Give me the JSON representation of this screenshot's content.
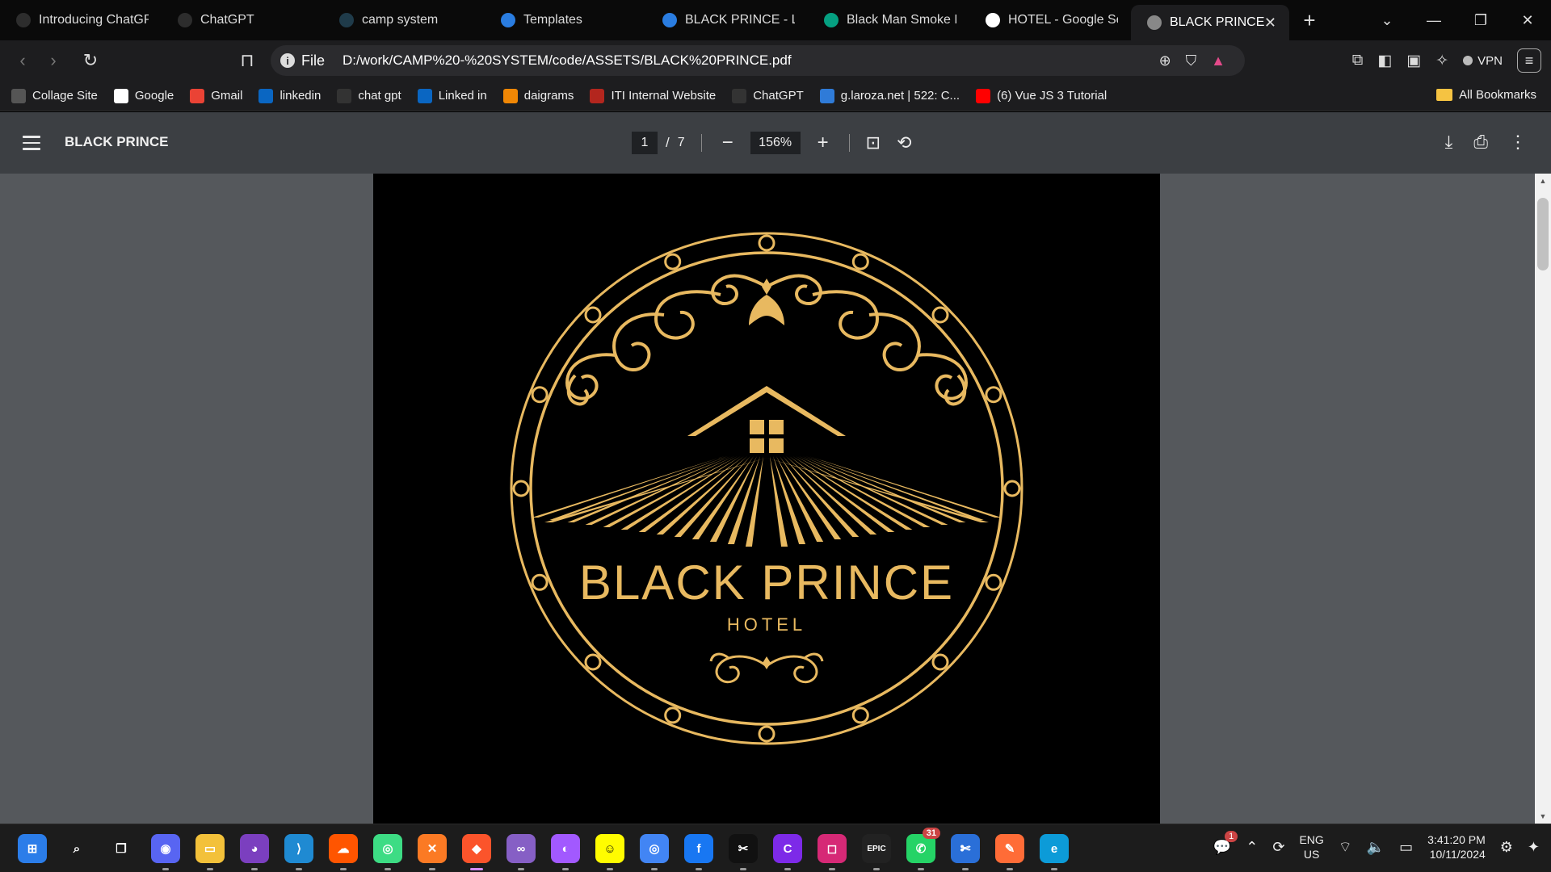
{
  "tabs": [
    {
      "label": "Introducing ChatGPT",
      "icon": "openai-icon",
      "color": "#2d2d2d"
    },
    {
      "label": "ChatGPT",
      "icon": "openai-icon",
      "color": "#2d2d2d"
    },
    {
      "label": "camp system",
      "icon": "react-icon",
      "color": "#1f3b4a"
    },
    {
      "label": "Templates",
      "icon": "canva-icon",
      "color": "#2a7de1"
    },
    {
      "label": "BLACK PRINCE - Logo",
      "icon": "canva-icon",
      "color": "#2a7de1"
    },
    {
      "label": "Black Man Smoke Ph",
      "icon": "pexels-icon",
      "color": "#05a081"
    },
    {
      "label": "HOTEL - Google Sear",
      "icon": "google-icon",
      "color": "#ffffff"
    },
    {
      "label": "BLACK PRINCE",
      "icon": "globe-icon",
      "color": "#888888",
      "active": true
    }
  ],
  "address": {
    "scheme_label": "File",
    "url": "D:/work/CAMP%20-%20SYSTEM/code/ASSETS/BLACK%20PRINCE.pdf"
  },
  "toolbar": {
    "vpn_label": "VPN"
  },
  "bookmarks": [
    {
      "label": "Collage Site",
      "color": "#555555"
    },
    {
      "label": "Google",
      "color": "#ffffff"
    },
    {
      "label": "Gmail",
      "color": "#ea4335"
    },
    {
      "label": "linkedin",
      "color": "#0a66c2"
    },
    {
      "label": "chat gpt",
      "color": "#333333"
    },
    {
      "label": "Linked in",
      "color": "#0a66c2"
    },
    {
      "label": "daigrams",
      "color": "#f08705"
    },
    {
      "label": "ITI Internal Website",
      "color": "#b3261e"
    },
    {
      "label": "ChatGPT",
      "color": "#333333"
    },
    {
      "label": "g.laroza.net | 522: C...",
      "color": "#2f7bd8"
    },
    {
      "label": "(6) Vue JS 3 Tutorial",
      "color": "#ff0000"
    }
  ],
  "bookmarks_all": "All Bookmarks",
  "pdf": {
    "title": "BLACK PRINCE",
    "current_page": "1",
    "total_pages": "7",
    "zoom": "156%",
    "logo_title": "BLACK PRINCE",
    "logo_subtitle": "HOTEL",
    "gold": "#e8b960"
  },
  "taskbar": {
    "apps": [
      {
        "name": "start-button",
        "color": "#2b7de9",
        "glyph": "⊞"
      },
      {
        "name": "search-button",
        "color": "transparent",
        "glyph": "⌕"
      },
      {
        "name": "task-view-button",
        "color": "transparent",
        "glyph": "❐"
      },
      {
        "name": "discord-app",
        "color": "#5865f2",
        "glyph": "◉"
      },
      {
        "name": "file-explorer-app",
        "color": "#f3c13a",
        "glyph": "▭"
      },
      {
        "name": "github-desktop-app",
        "color": "#7b3fbf",
        "glyph": "◕"
      },
      {
        "name": "vscode-app",
        "color": "#1f8ad2",
        "glyph": "⟩"
      },
      {
        "name": "soundcloud-app",
        "color": "#ff5500",
        "glyph": "☁"
      },
      {
        "name": "android-studio-app",
        "color": "#3ddc84",
        "glyph": "◎"
      },
      {
        "name": "xampp-app",
        "color": "#fb7a24",
        "glyph": "✕"
      },
      {
        "name": "brave-app",
        "color": "#fb542b",
        "glyph": "◆",
        "active": true
      },
      {
        "name": "visual-studio-app",
        "color": "#865fc5",
        "glyph": "∞"
      },
      {
        "name": "figma-app",
        "color": "#a259ff",
        "glyph": "◐"
      },
      {
        "name": "snapchat-app",
        "color": "#fffc00",
        "glyph": "☺"
      },
      {
        "name": "chrome-app",
        "color": "#4285f4",
        "glyph": "◎"
      },
      {
        "name": "facebook-app",
        "color": "#1877f2",
        "glyph": "f"
      },
      {
        "name": "capcut-app",
        "color": "#111111",
        "glyph": "✂"
      },
      {
        "name": "canva-app",
        "color": "#7d2ae8",
        "glyph": "C"
      },
      {
        "name": "instagram-app",
        "color": "#d62976",
        "glyph": "◻"
      },
      {
        "name": "epic-games-app",
        "color": "#222222",
        "glyph": "EPIC"
      },
      {
        "name": "whatsapp-app",
        "color": "#25d366",
        "glyph": "✆",
        "badge": "31"
      },
      {
        "name": "snipping-tool-app",
        "color": "#2a6fd8",
        "glyph": "✄"
      },
      {
        "name": "postman-app",
        "color": "#ff6c37",
        "glyph": "✎"
      },
      {
        "name": "edge-app",
        "color": "#0c9bd8",
        "glyph": "e"
      }
    ],
    "chat_badge": "1",
    "lang_top": "ENG",
    "lang_bottom": "US",
    "time": "3:41:20 PM",
    "date": "10/11/2024"
  }
}
